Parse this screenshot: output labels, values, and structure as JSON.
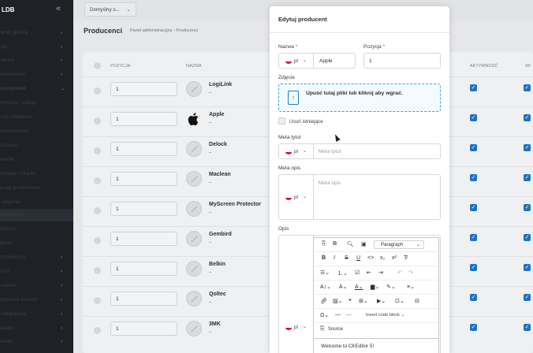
{
  "sidebar": {
    "logo": "LDB",
    "collapse_icon": "double-chevron-left-icon",
    "items": [
      {
        "label": "Panel główny",
        "chevron": "›",
        "active": false
      },
      {
        "label": "Logi",
        "chevron": "›",
        "active": false
      },
      {
        "label": "Faktury",
        "chevron": "›",
        "active": false
      },
      {
        "label": "Zamówienia",
        "chevron": "›",
        "active": false
      },
      {
        "label": "Asortyment",
        "chevron": "⌄",
        "active": true
      },
      {
        "label": "Produkty / Usługi",
        "chevron": "",
        "active": false
      },
      {
        "label": "Kody rabatowe",
        "chevron": "",
        "active": false
      },
      {
        "label": "Zastosowanie",
        "chevron": "",
        "active": false
      },
      {
        "label": "Dostawy",
        "chevron": "",
        "active": false
      },
      {
        "label": "Cenniki",
        "chevron": "",
        "active": false
      },
      {
        "label": "Prowizje / Marże",
        "chevron": "",
        "active": false
      },
      {
        "label": "Grupy produktowe",
        "chevron": "",
        "active": false
      },
      {
        "label": "Kategorie",
        "chevron": "",
        "active": false
      },
      {
        "label": "Producenci",
        "chevron": "",
        "active": true
      },
      {
        "label": "Atrybuty",
        "chevron": "",
        "active": false
      },
      {
        "label": "Opinie",
        "chevron": "",
        "active": false
      },
      {
        "label": "Użytkownicy",
        "chevron": "›",
        "active": false
      },
      {
        "label": "Treść",
        "chevron": "›",
        "active": false
      },
      {
        "label": "Szablon",
        "chevron": "›",
        "active": false
      },
      {
        "label": "Wymiana danych",
        "chevron": "›",
        "active": false
      },
      {
        "label": "Konfiguracja",
        "chevron": "›",
        "active": false
      },
      {
        "label": "Allegro",
        "chevron": "›",
        "active": false
      },
      {
        "label": "Zlando",
        "chevron": "›",
        "active": false
      }
    ]
  },
  "topbar": {
    "shop_select": "Domyślny s...",
    "caret": "⌄"
  },
  "page": {
    "title": "Producenci",
    "breadcrumb": "Panel administracyjny  ›  Producenci"
  },
  "table": {
    "headers": {
      "position": "POZYCJA",
      "name": "NAZWA",
      "active": "AKTYWNOŚĆ",
      "extra": "WI"
    },
    "rows": [
      {
        "position": "1",
        "name": "LogiLink",
        "sub": "–"
      },
      {
        "position": "1",
        "name": "Apple",
        "sub": "–"
      },
      {
        "position": "1",
        "name": "Delock",
        "sub": "–"
      },
      {
        "position": "1",
        "name": "Maclean",
        "sub": "–"
      },
      {
        "position": "1",
        "name": "MyScreen Protector",
        "sub": "–"
      },
      {
        "position": "1",
        "name": "Gembird",
        "sub": "–"
      },
      {
        "position": "1",
        "name": "Belkin",
        "sub": "–"
      },
      {
        "position": "1",
        "name": "Qoltec",
        "sub": "–"
      },
      {
        "position": "1",
        "name": "3MK",
        "sub": "–"
      }
    ],
    "checkmark": "✓"
  },
  "modal": {
    "title": "Edytuj producent",
    "name_label": "Nazwa",
    "required_mark": "*",
    "position_label": "Pozycja",
    "lang_code": "pl",
    "lang_caret": "⌄",
    "name_value": "Apple",
    "position_value": "1",
    "photo_label": "Zdjęcie",
    "dropzone_text": "Upuść tutaj pliki lub kliknij aby wgrać.",
    "upload_icon": "↑",
    "remove_existing": "Usuń istniejące",
    "meta_title_label": "Meta tytuł",
    "meta_title_placeholder": "Meta tytuł",
    "meta_desc_label": "Meta opis",
    "meta_desc_placeholder": "Meta opis",
    "desc_label": "Opis",
    "editor": {
      "paragraph": "Paragraph",
      "paragraph_caret": "⌄",
      "code_lang": "Insert code block",
      "code_lang_short": "Insert code block",
      "source": "Source",
      "content": "Welcome to CKEditor 5!"
    }
  },
  "colors": {
    "accent": "#1d72c4",
    "sidebar_bg": "#1e2126",
    "dropzone_border": "#3ba3d8",
    "required": "#d9434f"
  }
}
